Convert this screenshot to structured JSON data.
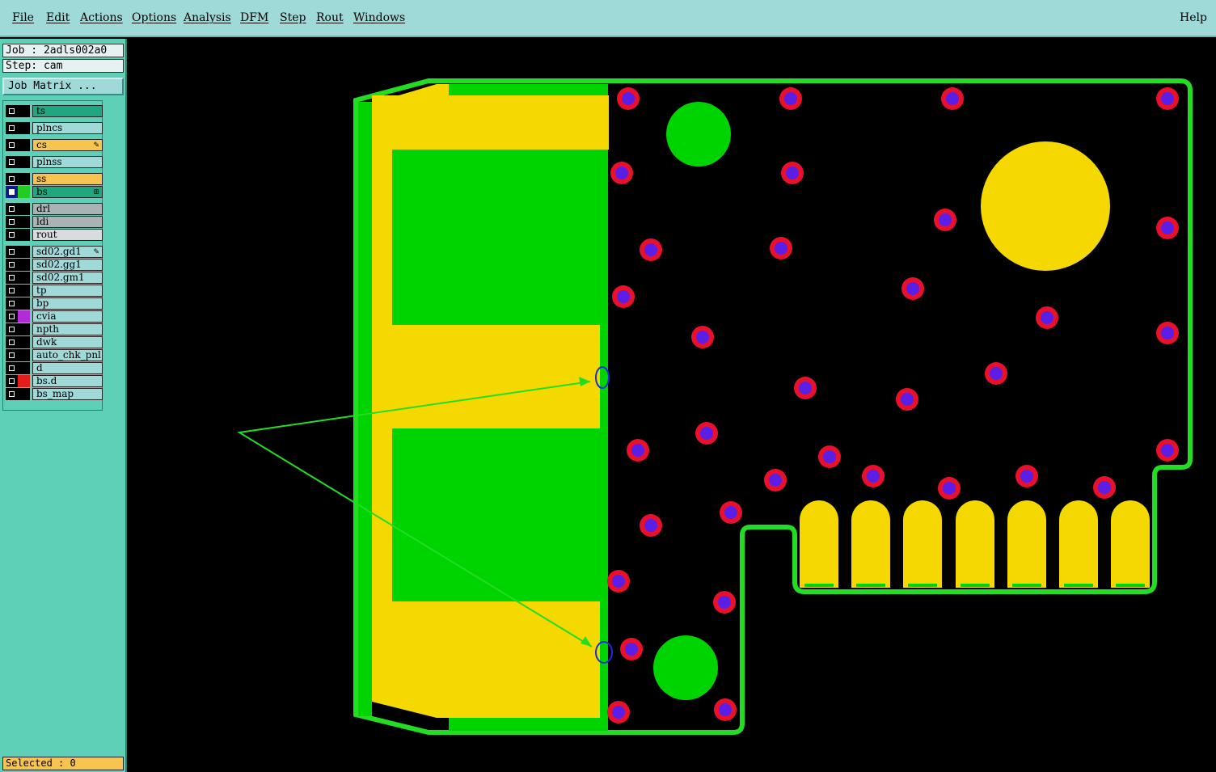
{
  "menubar": {
    "items": [
      "File",
      "Edit",
      "Actions",
      "Options",
      "Analysis",
      "DFM",
      "Step",
      "Rout",
      "Windows"
    ],
    "help": "Help"
  },
  "sidebar": {
    "job_line": "Job : 2adls002a0",
    "step_line": "Step: cam",
    "job_matrix_button": "Job Matrix ...",
    "layers": [
      {
        "name": "ts",
        "color": "#1fa87f",
        "swatch": "#000000",
        "checked": false
      },
      {
        "name": "plncs",
        "color": "#9fd9d8",
        "swatch": "#000000",
        "checked": false
      },
      {
        "name": "cs",
        "color": "#f7c44f",
        "swatch": "#000000",
        "checked": false,
        "mark": "pencil"
      },
      {
        "name": "plnss",
        "color": "#9fd9d8",
        "swatch": "#000000",
        "checked": false
      },
      {
        "name": "ss",
        "color": "#f7c44f",
        "swatch": "#000000",
        "checked": false
      },
      {
        "name": "bs",
        "color": "#1fa87f",
        "swatch": "#22cc22",
        "checked": true,
        "mark": "grid"
      },
      {
        "name": "drl",
        "color": "#a9b3b5",
        "swatch": "#000000",
        "checked": false
      },
      {
        "name": "ldi",
        "color": "#a9b3b5",
        "swatch": "#000000",
        "checked": false
      },
      {
        "name": "rout",
        "color": "#d9dcdc",
        "swatch": "#000000",
        "checked": false
      },
      {
        "name": "sd02.gd1",
        "color": "#9fd9d8",
        "swatch": "#000000",
        "checked": false,
        "mark": "pencil"
      },
      {
        "name": "sd02.gg1",
        "color": "#9fd9d8",
        "swatch": "#000000",
        "checked": false
      },
      {
        "name": "sd02.gm1",
        "color": "#9fd9d8",
        "swatch": "#000000",
        "checked": false
      },
      {
        "name": "tp",
        "color": "#9fd9d8",
        "swatch": "#000000",
        "checked": false
      },
      {
        "name": "bp",
        "color": "#9fd9d8",
        "swatch": "#000000",
        "checked": false
      },
      {
        "name": "cvia",
        "color": "#9fd9d8",
        "swatch": "#b32bd6",
        "checked": false
      },
      {
        "name": "npth",
        "color": "#9fd9d8",
        "swatch": "#000000",
        "checked": false
      },
      {
        "name": "dwk",
        "color": "#9fd9d8",
        "swatch": "#000000",
        "checked": false
      },
      {
        "name": "auto_chk_pnl",
        "color": "#9fd9d8",
        "swatch": "#000000",
        "checked": false
      },
      {
        "name": "d",
        "color": "#9fd9d8",
        "swatch": "#000000",
        "checked": false
      },
      {
        "name": "bs.d",
        "color": "#9fd9d8",
        "swatch": "#e51c1c",
        "checked": false
      },
      {
        "name": "bs_map",
        "color": "#9fd9d8",
        "swatch": "#000000",
        "checked": false
      }
    ],
    "selected": "Selected : 0"
  },
  "colors": {
    "board_outline": "#22dd22",
    "copper": "#00d400",
    "pad": "#f5d800",
    "via_ring": "#e8102a",
    "via_center": "#5a1fe6",
    "marker": "#1a2fd9"
  }
}
